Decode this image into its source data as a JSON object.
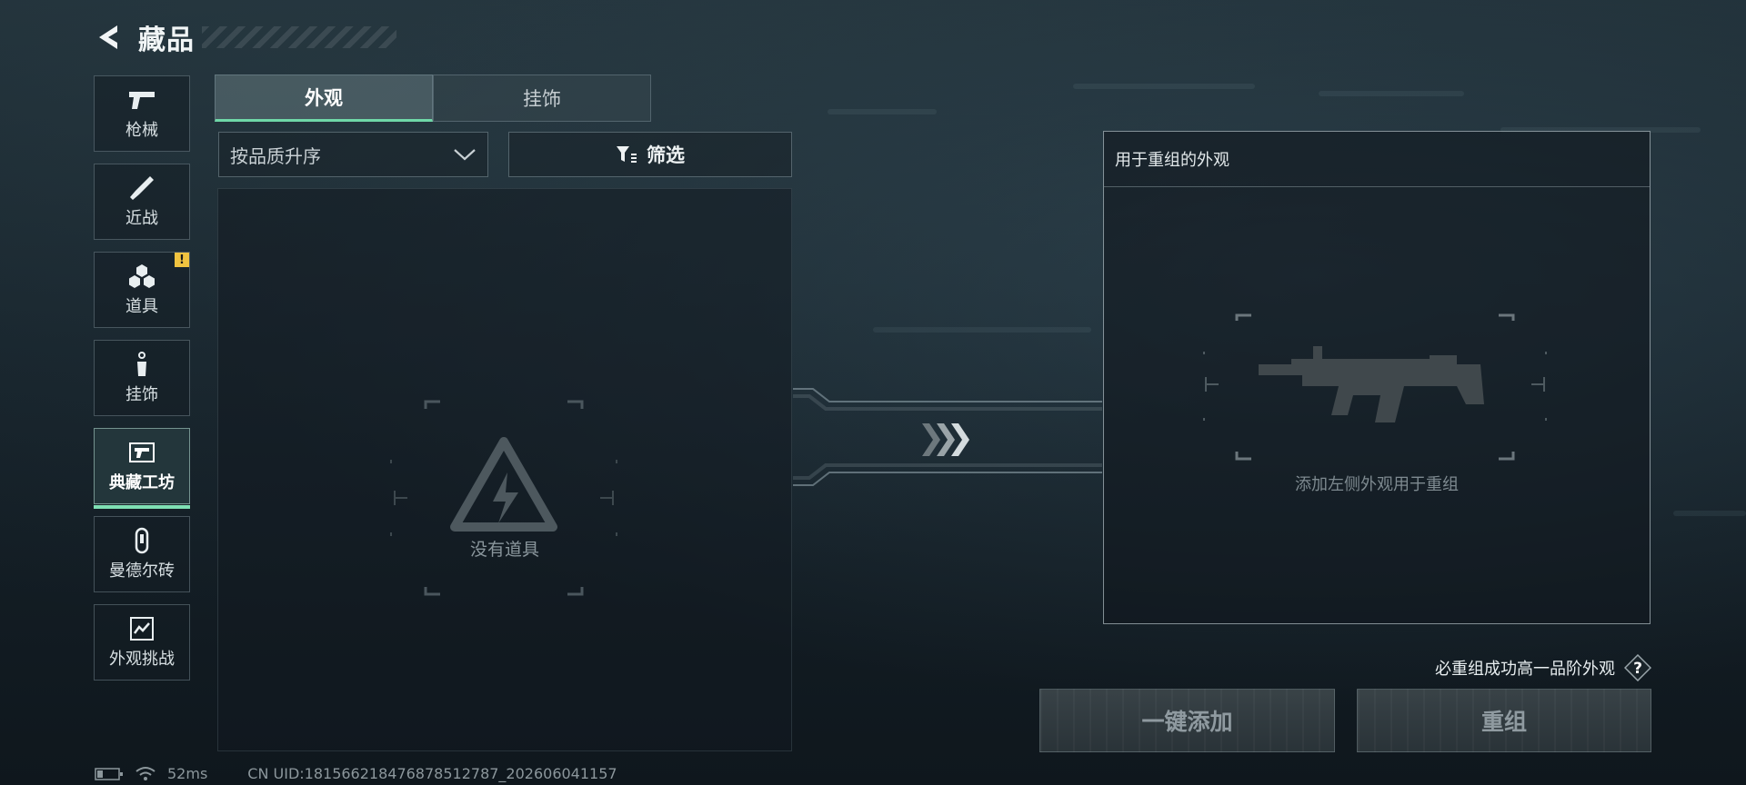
{
  "header": {
    "title": "藏品"
  },
  "sidebar": {
    "items": [
      {
        "label": "枪械",
        "icon": "pistol-icon"
      },
      {
        "label": "近战",
        "icon": "knife-icon"
      },
      {
        "label": "道具",
        "icon": "grenade-icon",
        "badge": "!"
      },
      {
        "label": "挂饰",
        "icon": "charm-icon"
      },
      {
        "label": "典藏工坊",
        "icon": "workshop-icon",
        "active": true
      },
      {
        "label": "曼德尔砖",
        "icon": "mandel-brick-icon"
      },
      {
        "label": "外观挑战",
        "icon": "challenge-icon"
      }
    ]
  },
  "tabs": [
    {
      "label": "外观",
      "active": true
    },
    {
      "label": "挂饰",
      "active": false
    }
  ],
  "sort": {
    "value": "按品质升序"
  },
  "filter": {
    "label": "筛选"
  },
  "item_list": {
    "empty_text": "没有道具"
  },
  "recombine": {
    "title": "用于重组的外观",
    "hint": "添加左侧外观用于重组",
    "guarantee_text": "必重组成功高一品阶外观",
    "help_label": "?",
    "add_button": "一键添加",
    "recombine_button": "重组"
  },
  "status": {
    "ping": "52ms",
    "uid": "CN UID:181566218476878512787_202606041157"
  },
  "colors": {
    "accent": "#6fd8a8",
    "warning": "#f0c340"
  }
}
